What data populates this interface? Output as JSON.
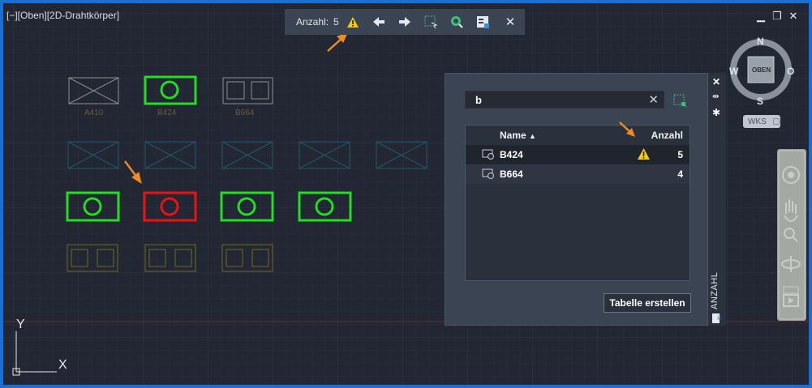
{
  "viewport": {
    "label": "[−][Oben][2D-Drahtkörper]"
  },
  "window_controls": [
    "minimize",
    "restore",
    "close"
  ],
  "count_toolbar": {
    "label": "Anzahl:",
    "count": "5",
    "buttons": [
      "warning-icon",
      "previous-icon",
      "next-icon",
      "select-objects-icon",
      "zoom-to-icon",
      "insert-field-icon",
      "close-icon"
    ]
  },
  "drawing": {
    "block_labels": [
      "A410",
      "B424",
      "B664"
    ]
  },
  "ucs": {
    "y": "Y",
    "x": "X"
  },
  "count_palette": {
    "title": "ANZAHL",
    "search": {
      "value": "b"
    },
    "table": {
      "headers": {
        "name": "Name",
        "count": "Anzahl"
      },
      "rows": [
        {
          "name": "B424",
          "count": "5",
          "warning": true
        },
        {
          "name": "B664",
          "count": "4",
          "warning": false
        }
      ]
    },
    "create_table_button": "Tabelle erstellen"
  },
  "viewcube": {
    "north": "N",
    "south": "S",
    "east": "O",
    "west": "W",
    "face": "OBEN",
    "wcs": "WKS"
  },
  "colors": {
    "background": "#222733",
    "highlight_green": "#22dd22",
    "highlight_red": "#ee1111",
    "warning_yellow": "#f2c81a",
    "annotation_orange": "#f08a24"
  }
}
